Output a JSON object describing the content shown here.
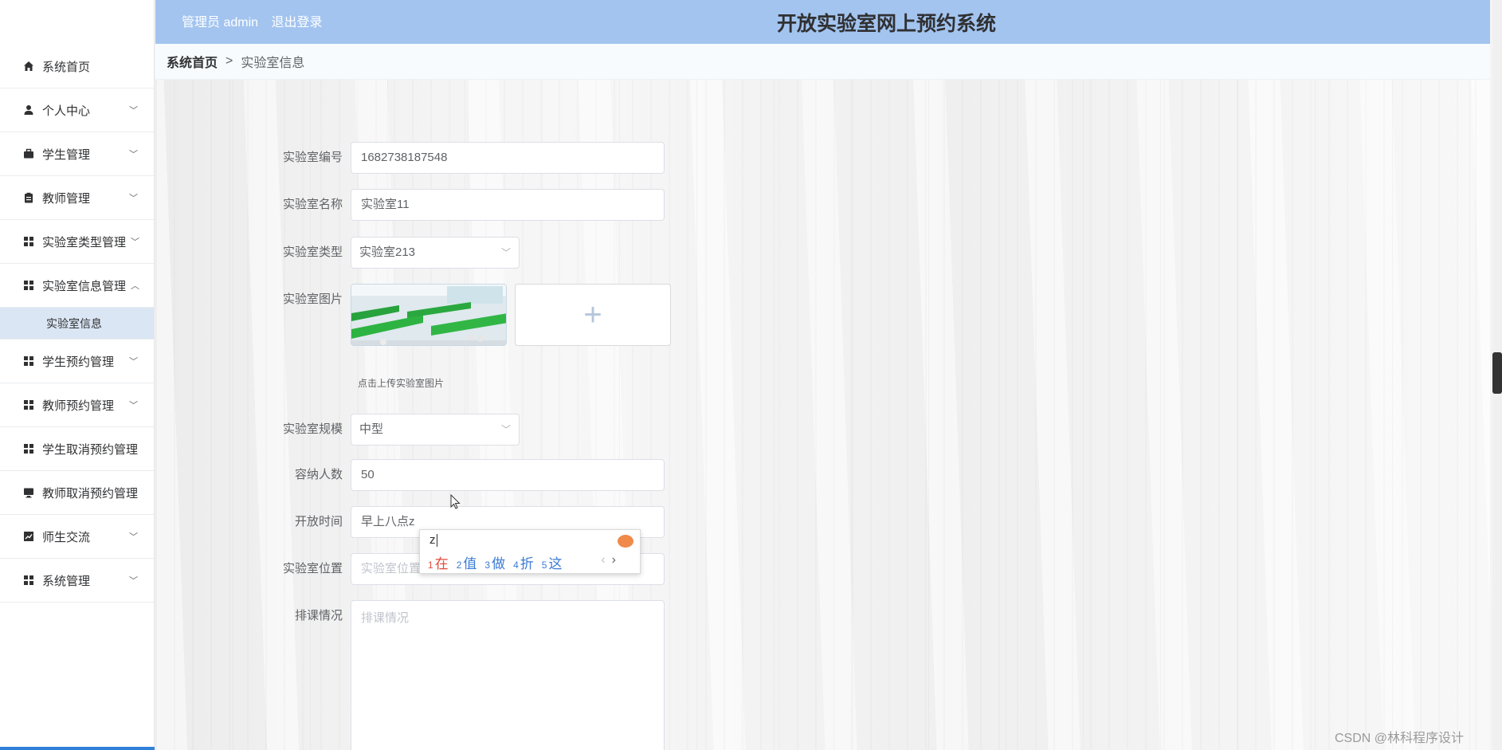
{
  "header": {
    "admin_text": "管理员 admin",
    "logout": "退出登录",
    "title": "开放实验室网上预约系统"
  },
  "sidebar": {
    "items": [
      {
        "label": "系统首页",
        "icon": "home-icon",
        "arrow": ""
      },
      {
        "label": "个人中心",
        "icon": "user-icon",
        "arrow": "﹀"
      },
      {
        "label": "学生管理",
        "icon": "briefcase-icon",
        "arrow": "﹀"
      },
      {
        "label": "教师管理",
        "icon": "clipboard-icon",
        "arrow": "﹀"
      },
      {
        "label": "实验室类型管理",
        "icon": "grid-icon",
        "arrow": "﹀"
      },
      {
        "label": "实验室信息管理",
        "icon": "grid-icon",
        "arrow": "︿"
      },
      {
        "label": "学生预约管理",
        "icon": "grid-icon",
        "arrow": "﹀"
      },
      {
        "label": "教师预约管理",
        "icon": "grid-icon",
        "arrow": "﹀"
      },
      {
        "label": "学生取消预约管理",
        "icon": "grid-icon",
        "arrow": ""
      },
      {
        "label": "教师取消预约管理",
        "icon": "monitor-icon",
        "arrow": ""
      },
      {
        "label": "师生交流",
        "icon": "chart-icon",
        "arrow": "﹀"
      },
      {
        "label": "系统管理",
        "icon": "grid-icon",
        "arrow": "﹀"
      }
    ],
    "submenu_active": "实验室信息"
  },
  "breadcrumb": {
    "home": "系统首页",
    "separator": ">",
    "current": "实验室信息"
  },
  "form": {
    "lab_number": {
      "label": "实验室编号",
      "value": "1682738187548"
    },
    "lab_name": {
      "label": "实验室名称",
      "value": "实验室11"
    },
    "lab_type": {
      "label": "实验室类型",
      "value": "实验室213"
    },
    "lab_image": {
      "label": "实验室图片",
      "hint": "点击上传实验室图片",
      "upload_symbol": "+"
    },
    "lab_scale": {
      "label": "实验室规模",
      "value": "中型"
    },
    "capacity": {
      "label": "容纳人数",
      "value": "50"
    },
    "open_time": {
      "label": "开放时间",
      "value": "早上八点z"
    },
    "location": {
      "label": "实验室位置",
      "placeholder": "实验室位置"
    },
    "schedule": {
      "label": "排课情况",
      "placeholder": "排课情况"
    }
  },
  "ime": {
    "typed": "z",
    "candidates": [
      {
        "num": "1",
        "text": "在"
      },
      {
        "num": "2",
        "text": "值"
      },
      {
        "num": "3",
        "text": "做"
      },
      {
        "num": "4",
        "text": "折"
      },
      {
        "num": "5",
        "text": "这"
      }
    ],
    "prev": "‹",
    "next": "›"
  },
  "watermark": "CSDN @林科程序设计",
  "colors": {
    "header_bg": "#a3c4ef",
    "submenu_active_bg": "#dbe6f4",
    "ime_first": "#e04a3a",
    "ime_cand": "#3a7bd5"
  }
}
